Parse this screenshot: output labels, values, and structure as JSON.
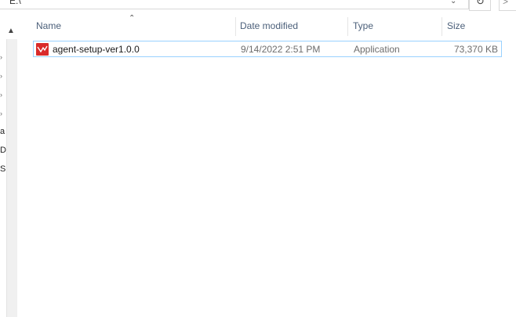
{
  "address_bar": {
    "path_text": "E:\\",
    "dropdown_icon": "chevron-down-icon",
    "refresh_icon": "refresh-icon",
    "forward_icon": "chevron-right-icon"
  },
  "nav_pane": {
    "fragments": [
      "a",
      "D/",
      "S:"
    ]
  },
  "columns": {
    "name": "Name",
    "date_modified": "Date modified",
    "type": "Type",
    "size": "Size",
    "sort_icon": "sort-ascending-icon"
  },
  "files": [
    {
      "name": "agent-setup-ver1.0.0",
      "date_modified": "9/14/2022 2:51 PM",
      "type": "Application",
      "size": "73,370 KB",
      "icon": "application-icon",
      "icon_color": "#d92b2b",
      "selected": true
    }
  ],
  "colors": {
    "selection_border": "#99d1ff",
    "header_text": "#4c607a",
    "detail_text": "#6d6d6d"
  }
}
